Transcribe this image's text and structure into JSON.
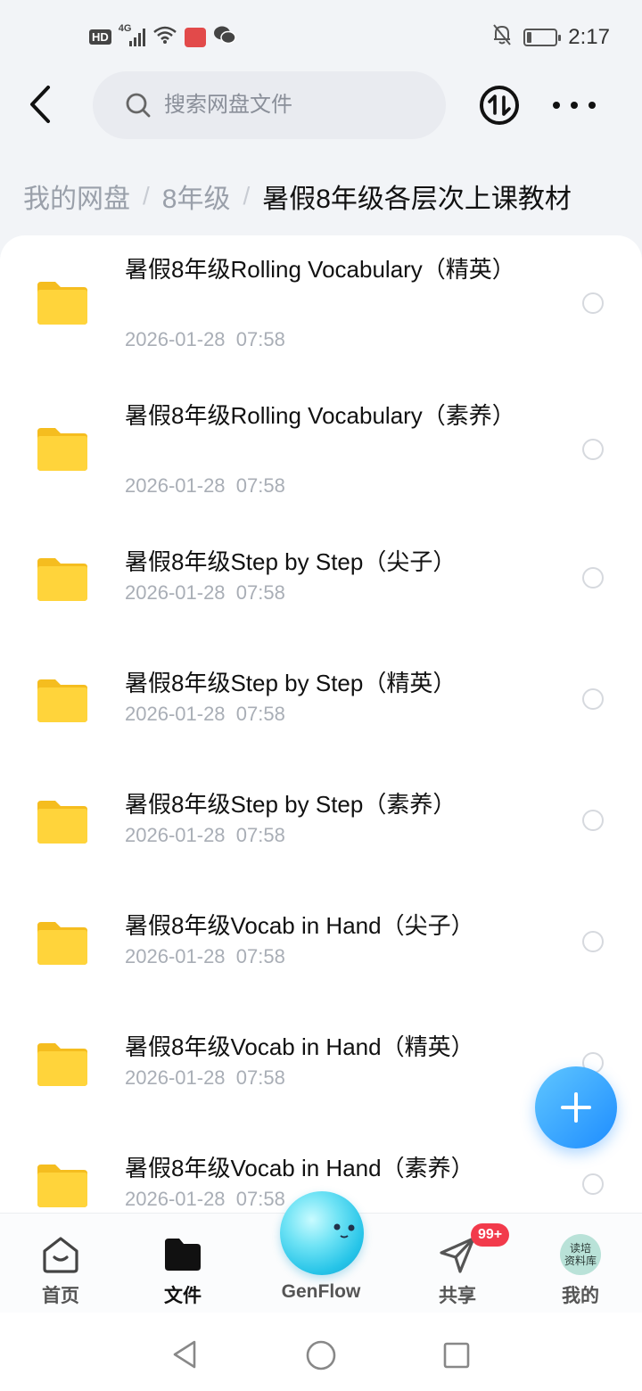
{
  "status_bar": {
    "network_badge": "HD",
    "signal_label": "4G",
    "time": "2:17",
    "battery_level": 0.15
  },
  "header": {
    "search_placeholder": "搜索网盘文件"
  },
  "breadcrumb": {
    "items": [
      "我的网盘",
      "8年级",
      "暑假8年级各层次上课教材"
    ]
  },
  "files": [
    {
      "name": "暑假8年级Rolling Vocabulary（精英）",
      "modified": "2026-01-28  07:58"
    },
    {
      "name": "暑假8年级Rolling Vocabulary（素养）",
      "modified": "2026-01-28  07:58"
    },
    {
      "name": "暑假8年级Step by Step（尖子）",
      "modified": "2026-01-28  07:58"
    },
    {
      "name": "暑假8年级Step by Step（精英）",
      "modified": "2026-01-28  07:58"
    },
    {
      "name": "暑假8年级Step by Step（素养）",
      "modified": "2026-01-28  07:58"
    },
    {
      "name": "暑假8年级Vocab in Hand（尖子）",
      "modified": "2026-01-28  07:58"
    },
    {
      "name": "暑假8年级Vocab in Hand（精英）",
      "modified": "2026-01-28  07:58"
    },
    {
      "name": "暑假8年级Vocab in Hand（素养）",
      "modified": "2026-01-28  07:58"
    }
  ],
  "tab_bar": {
    "tabs": [
      {
        "label": "首页",
        "icon": "home-icon"
      },
      {
        "label": "文件",
        "icon": "folder-icon"
      },
      {
        "label": "GenFlow",
        "icon": "genflow-orb-icon"
      },
      {
        "label": "共享",
        "icon": "share-send-icon"
      },
      {
        "label": "我的",
        "icon": "avatar"
      }
    ],
    "share_badge": "99+",
    "avatar_text": [
      "读培",
      "资料库"
    ],
    "active_tab": "文件"
  },
  "colors": {
    "accent": "#1e8dff",
    "folder": "#ffd43b",
    "badge": "#f23a4b"
  }
}
